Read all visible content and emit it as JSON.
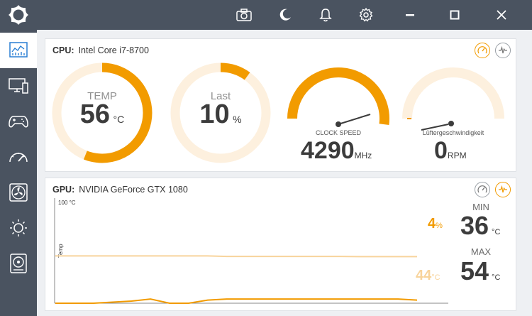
{
  "titlebar": {
    "buttons": [
      {
        "name": "camera-icon"
      },
      {
        "name": "moon-icon"
      },
      {
        "name": "bell-icon"
      },
      {
        "name": "gear-icon"
      },
      {
        "name": "minimize-icon"
      },
      {
        "name": "maximize-icon"
      },
      {
        "name": "close-icon"
      }
    ]
  },
  "sidebar": {
    "items": [
      {
        "name": "dashboard-icon",
        "active": true
      },
      {
        "name": "monitor-icon",
        "active": false
      },
      {
        "name": "gamepad-icon",
        "active": false
      },
      {
        "name": "speedometer-icon",
        "active": false
      },
      {
        "name": "fan-icon",
        "active": false
      },
      {
        "name": "brightness-icon",
        "active": false
      },
      {
        "name": "storage-icon",
        "active": false
      }
    ]
  },
  "cpu": {
    "label": "CPU:",
    "model": "Intel Core i7-8700",
    "temp": {
      "label": "TEMP",
      "value": "56",
      "unit": "°C",
      "fraction": 0.56
    },
    "load": {
      "label": "Last",
      "value": "10",
      "unit": "%",
      "fraction": 0.1
    },
    "clock": {
      "label": "CLOCK SPEED",
      "value": "4290",
      "unit": "MHz",
      "fraction": 0.72
    },
    "fan": {
      "label": "Lüftergeschwindigkeit",
      "value": "0",
      "unit": "RPM",
      "fraction": 0.0
    }
  },
  "gpu": {
    "label": "GPU:",
    "model": "NVIDIA GeForce GTX 1080",
    "chart": {
      "ymax_label": "100 °C",
      "ylabel": "Temp",
      "temp_series": [
        45,
        45,
        45,
        45,
        45,
        45,
        45,
        45,
        45,
        44.5,
        44.5,
        44.5,
        44.5,
        44.5,
        44.5,
        44.5,
        44.3,
        44.3,
        44.3,
        44.3
      ],
      "load_series": [
        0,
        0,
        0,
        1,
        2,
        4,
        0,
        0,
        3,
        4,
        4,
        4,
        4,
        4,
        4,
        4,
        4,
        4,
        4,
        3
      ]
    },
    "load_pct": {
      "value": "4",
      "unit": "%"
    },
    "temp_pct": {
      "value": "44",
      "unit": "°C"
    },
    "min": {
      "label": "MIN",
      "value": "36",
      "unit": "°C"
    },
    "max": {
      "label": "MAX",
      "value": "54",
      "unit": "°C"
    }
  },
  "colors": {
    "accent": "#f29b00",
    "accent_light": "#fdf0de",
    "chart_temp": "#f8d49c",
    "bar": "#4a5360"
  }
}
